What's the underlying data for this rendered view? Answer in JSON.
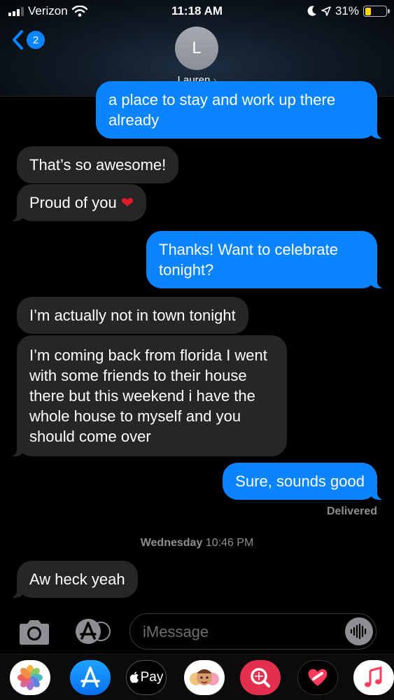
{
  "status_bar": {
    "carrier": "Verizon",
    "time": "11:18 AM",
    "battery": "31%",
    "battery_level": 0.31
  },
  "header": {
    "back_badge": "2",
    "avatar_initial": "L",
    "contact_name": "Lauren",
    "chevron": "›"
  },
  "messages": [
    {
      "direction": "outgoing",
      "text": "a place to stay and work up there already"
    },
    {
      "direction": "incoming",
      "text": "That’s so awesome!"
    },
    {
      "direction": "incoming",
      "text": "Proud of you"
    },
    {
      "direction": "outgoing",
      "text": "Thanks! Want to celebrate tonight?"
    },
    {
      "direction": "incoming",
      "text": "I’m actually not in town tonight"
    },
    {
      "direction": "incoming",
      "text": "I’m coming back from florida I went with some friends to their house there but this weekend i have the whole house to myself and you should come over"
    },
    {
      "direction": "outgoing",
      "text": "Sure, sounds good"
    },
    {
      "direction": "incoming",
      "text": "Aw heck yeah"
    }
  ],
  "heart_emoji": "❤",
  "delivered_label": "Delivered",
  "date_stamp": {
    "day": "Wednesday",
    "time": "10:46 PM"
  },
  "input": {
    "placeholder": "iMessage"
  },
  "app_drawer": {
    "apple_pay_label": "Pay",
    "apps": [
      "photos-icon",
      "app-store-icon",
      "apple-pay-icon",
      "memoji-icon",
      "search-images-icon",
      "digital-touch-icon",
      "music-icon"
    ]
  },
  "colors": {
    "outgoing": "#0a84ff",
    "incoming": "#262628",
    "accent": "#0a84ff"
  }
}
